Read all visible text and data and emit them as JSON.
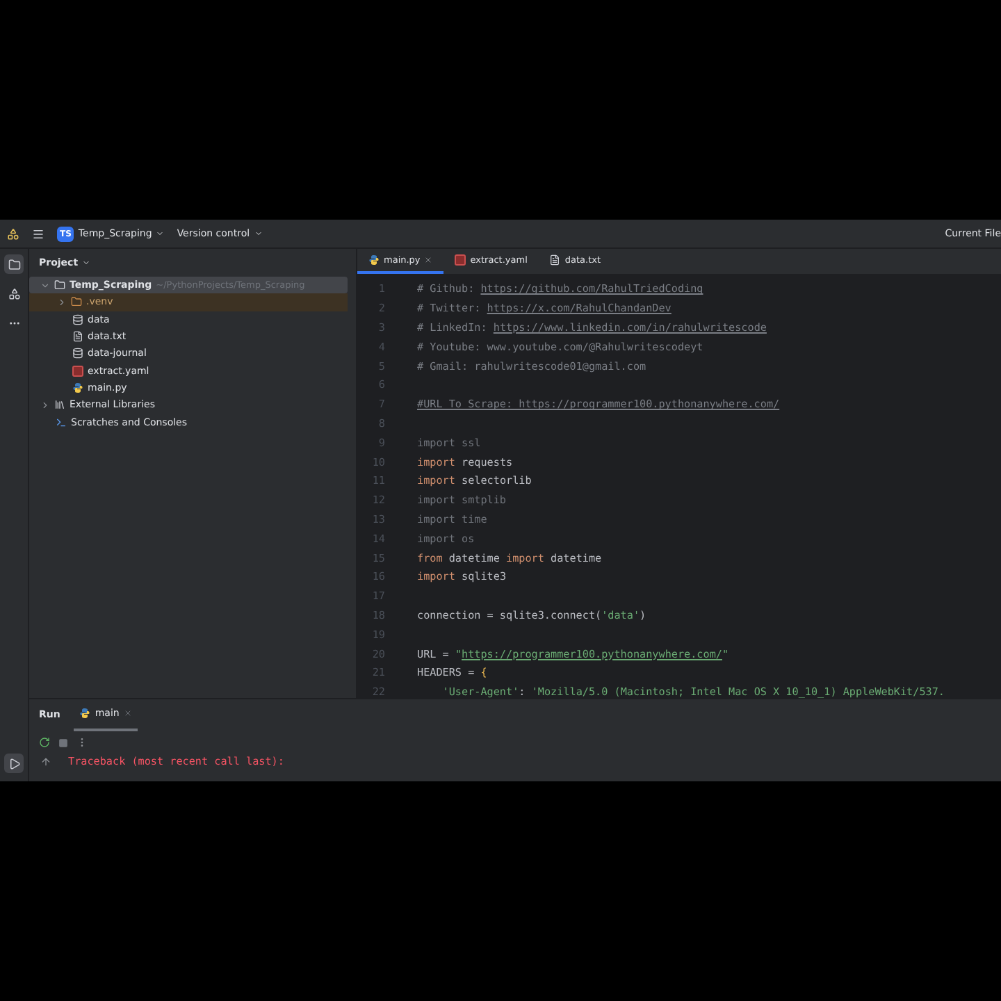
{
  "toolbar": {
    "project_badge": "TS",
    "project": "Temp_Scraping",
    "vcs": "Version control",
    "right_label": "Current File"
  },
  "project_panel": {
    "title": "Project",
    "tree": [
      {
        "label": "Temp_Scraping",
        "path": "~/PythonProjects/Temp_Scraping",
        "kind": "folder",
        "expanded": true,
        "selected": true,
        "children": [
          {
            "label": ".venv",
            "kind": "excluded-folder",
            "expanded": false,
            "selected": false
          },
          {
            "label": "data",
            "kind": "database",
            "selected": false
          },
          {
            "label": "data.txt",
            "kind": "text",
            "selected": false
          },
          {
            "label": "data-journal",
            "kind": "database",
            "selected": false
          },
          {
            "label": "extract.yaml",
            "kind": "yaml",
            "selected": false
          },
          {
            "label": "main.py",
            "kind": "python",
            "selected": false
          }
        ]
      },
      {
        "label": "External Libraries",
        "kind": "library",
        "expanded": false,
        "selected": false
      },
      {
        "label": "Scratches and Consoles",
        "kind": "scratches",
        "selected": false
      }
    ]
  },
  "editor": {
    "tabs": [
      {
        "label": "main.py",
        "kind": "python",
        "selected": true
      },
      {
        "label": "extract.yaml",
        "kind": "yaml",
        "selected": false
      },
      {
        "label": "data.txt",
        "kind": "text",
        "selected": false
      }
    ],
    "lines": [
      {
        "number": "1",
        "tokens": [
          {
            "kind": "comment",
            "text": "# Github: "
          },
          {
            "kind": "comment-link",
            "text": "https://github.com/RahulTriedCoding"
          }
        ]
      },
      {
        "number": "2",
        "tokens": [
          {
            "kind": "comment",
            "text": "# Twitter: "
          },
          {
            "kind": "comment-link",
            "text": "https://x.com/RahulChandanDev"
          }
        ]
      },
      {
        "number": "3",
        "tokens": [
          {
            "kind": "comment",
            "text": "# LinkedIn: "
          },
          {
            "kind": "comment-link",
            "text": "https://www.linkedin.com/in/rahulwritescode"
          }
        ]
      },
      {
        "number": "4",
        "tokens": [
          {
            "kind": "comment",
            "text": "# Youtube: www.youtube.com/@Rahulwritescodeyt"
          }
        ]
      },
      {
        "number": "5",
        "tokens": [
          {
            "kind": "comment",
            "text": "# Gmail: rahulwritescode01@gmail.com"
          }
        ]
      },
      {
        "number": "6"
      },
      {
        "number": "7",
        "tokens": [
          {
            "kind": "comment-link",
            "text": "#URL To Scrape: https://programmer100.pythonanywhere.com/"
          }
        ]
      },
      {
        "number": "8"
      },
      {
        "number": "9",
        "tokens": [
          {
            "kind": "unused",
            "text": "import ssl"
          }
        ]
      },
      {
        "number": "10",
        "tokens": [
          {
            "kind": "keyword",
            "text": "import "
          },
          {
            "kind": "plain",
            "text": "requests"
          }
        ]
      },
      {
        "number": "11",
        "tokens": [
          {
            "kind": "keyword",
            "text": "import "
          },
          {
            "kind": "plain",
            "text": "selectorlib"
          }
        ]
      },
      {
        "number": "12",
        "tokens": [
          {
            "kind": "unused",
            "text": "import smtplib"
          }
        ]
      },
      {
        "number": "13",
        "tokens": [
          {
            "kind": "unused",
            "text": "import time"
          }
        ]
      },
      {
        "number": "14",
        "tokens": [
          {
            "kind": "unused",
            "text": "import os"
          }
        ]
      },
      {
        "number": "15",
        "tokens": [
          {
            "kind": "keyword",
            "text": "from "
          },
          {
            "kind": "plain",
            "text": "datetime "
          },
          {
            "kind": "keyword",
            "text": "import "
          },
          {
            "kind": "plain",
            "text": "datetime"
          }
        ]
      },
      {
        "number": "16",
        "tokens": [
          {
            "kind": "keyword",
            "text": "import "
          },
          {
            "kind": "plain",
            "text": "sqlite3"
          }
        ]
      },
      {
        "number": "17"
      },
      {
        "number": "18",
        "tokens": [
          {
            "kind": "plain",
            "text": "connection = sqlite3.connect("
          },
          {
            "kind": "string",
            "text": "'data'"
          },
          {
            "kind": "plain",
            "text": ")"
          }
        ]
      },
      {
        "number": "19"
      },
      {
        "number": "20",
        "tokens": [
          {
            "kind": "plain",
            "text": "URL = "
          },
          {
            "kind": "string",
            "text": "\""
          },
          {
            "kind": "string-link",
            "text": "https://programmer100.pythonanywhere.com/"
          },
          {
            "kind": "string",
            "text": "\""
          }
        ]
      },
      {
        "number": "21",
        "tokens": [
          {
            "kind": "plain",
            "text": "HEADERS = "
          },
          {
            "kind": "brace",
            "text": "{"
          }
        ]
      },
      {
        "number": "22",
        "tokens": [
          {
            "kind": "string",
            "text": "    'User-Agent'"
          },
          {
            "kind": "plain",
            "text": ": "
          },
          {
            "kind": "string",
            "text": "'Mozilla/5.0 (Macintosh; Intel Mac OS X 10_10_1) AppleWebKit/537."
          }
        ]
      }
    ]
  },
  "run_panel": {
    "title": "Run",
    "tabs": [
      {
        "label": "main",
        "kind": "python",
        "selected": true
      }
    ],
    "output": [
      {
        "kind": "error",
        "text": "Traceback (most recent call last):"
      }
    ]
  }
}
